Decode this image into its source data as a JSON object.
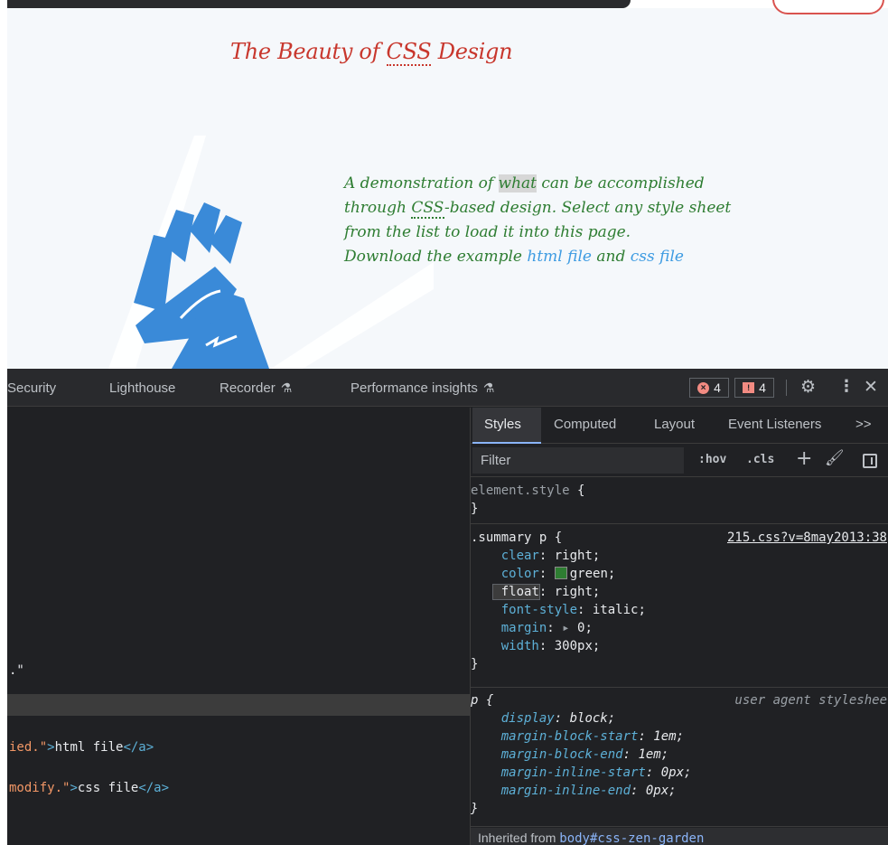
{
  "webpage": {
    "title_pre": "The Beauty of ",
    "title_abbr": "CSS",
    "title_post": " Design",
    "summary_seg1": "A demonstration of ",
    "summary_hl": "what",
    "summary_seg2": " can be accomplished",
    "summary_seg3": "through ",
    "summary_abbr": "CSS",
    "summary_seg4": "-based design. Select any style sheet",
    "summary_seg5": "from the list to load it into this page.",
    "summary_seg6": "Download the example ",
    "html_link": "html file",
    "summary_and": " and ",
    "css_link": "css file"
  },
  "devtools": {
    "tabs": [
      "Security",
      "Lighthouse",
      "Recorder",
      "Performance insights"
    ],
    "error_count": "4",
    "warning_count": "4",
    "elements": {
      "quote_fragment": ".\"",
      "line1_attr": "ied.\"",
      "line1_open": ">",
      "line1_text": "html file",
      "line1_close": "</a>",
      "line2_attr": "modify.\"",
      "line2_open": ">",
      "line2_text": "css file",
      "line2_close": "</a>"
    },
    "styles": {
      "tabs": [
        "Styles",
        "Computed",
        "Layout",
        "Event Listeners"
      ],
      "more_tabs": ">>",
      "filter_placeholder": "Filter",
      "hov": ":hov",
      "cls": ".cls",
      "element_style_selector": "element.style",
      "open_brace": " {",
      "close_brace": "}",
      "summary_selector": ".summary p",
      "summary_source": "215.css?v=8may2013:38",
      "summary_props": [
        {
          "name": "clear",
          "value": "right;"
        },
        {
          "name": "color",
          "value": "green;"
        },
        {
          "name": "float",
          "value": "right;"
        },
        {
          "name": "font-style",
          "value": "italic;"
        },
        {
          "name": "margin",
          "value": "0;"
        },
        {
          "name": "width",
          "value": "300px;"
        }
      ],
      "p_selector": "p",
      "p_source": "user agent styleshee",
      "p_props": [
        {
          "name": "display",
          "value": "block;"
        },
        {
          "name": "margin-block-start",
          "value": "1em;"
        },
        {
          "name": "margin-block-end",
          "value": "1em;"
        },
        {
          "name": "margin-inline-start",
          "value": "0px;"
        },
        {
          "name": "margin-inline-end",
          "value": "0px;"
        }
      ],
      "inherited_label": "Inherited from ",
      "inherited_link": "body#css-zen-garden"
    }
  },
  "colors": {
    "title_red": "#c8372d",
    "summary_green": "#2e7d32",
    "link_blue": "#3d9be2",
    "devtools_bg": "#202124"
  }
}
